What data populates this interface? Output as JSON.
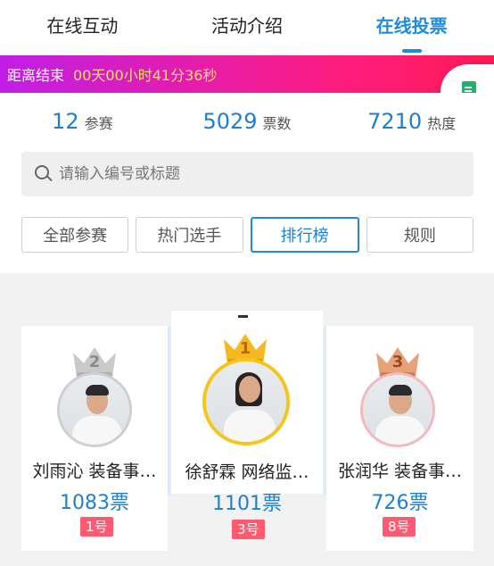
{
  "tabs": [
    {
      "label": "在线互动"
    },
    {
      "label": "活动介绍"
    },
    {
      "label": "在线投票"
    }
  ],
  "countdown": {
    "label": "距离结束",
    "value": "00天00小时41分36秒"
  },
  "stats": [
    {
      "value": "12",
      "label": "参赛"
    },
    {
      "value": "5029",
      "label": "票数"
    },
    {
      "value": "7210",
      "label": "热度"
    }
  ],
  "search": {
    "placeholder": "请输入编号或标题"
  },
  "filters": [
    {
      "label": "全部参赛"
    },
    {
      "label": "热门选手"
    },
    {
      "label": "排行榜"
    },
    {
      "label": "规则"
    }
  ],
  "podium": {
    "second": {
      "rank": "2",
      "name": "刘雨沁 装备事…",
      "votes": "1083票",
      "number": "1号"
    },
    "first": {
      "rank": "1",
      "name": "徐舒霖 网络监…",
      "votes": "1101票",
      "number": "3号"
    },
    "third": {
      "rank": "3",
      "name": "张润华 装备事…",
      "votes": "726票",
      "number": "8号"
    }
  },
  "colors": {
    "accent": "#1e8be0",
    "gold": "#f5b820",
    "silver": "#b7b7b7",
    "bronze": "#d98a5a",
    "badge": "#ff5a70"
  }
}
